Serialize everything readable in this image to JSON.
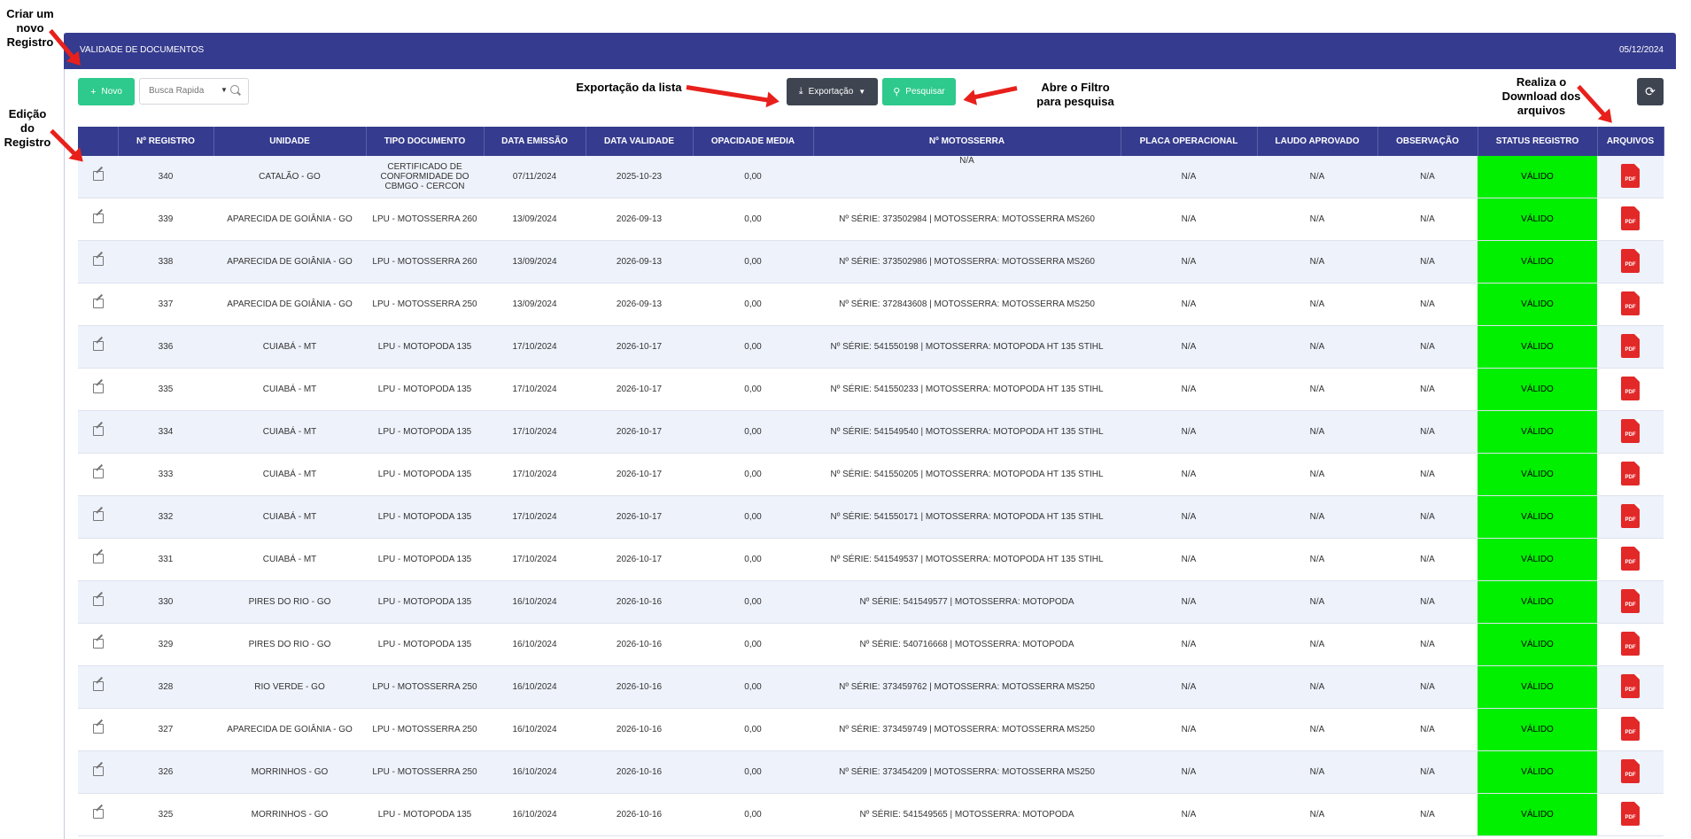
{
  "header": {
    "title": "VALIDADE DE DOCUMENTOS",
    "date": "05/12/2024"
  },
  "toolbar": {
    "novo_label": "Novo",
    "search_placeholder": "Busca Rapida",
    "export_label": "Exportação",
    "search_button_label": "Pesquisar"
  },
  "annotations": {
    "criar": "Criar um novo Registro",
    "edicao": "Edição do Registro",
    "exportacao": "Exportação da lista",
    "filtro": "Abre o Filtro para pesquisa",
    "download": "Realiza o Download dos arquivos"
  },
  "table": {
    "columns": [
      "",
      "Nº REGISTRO",
      "UNIDADE",
      "TIPO DOCUMENTO",
      "DATA EMISSÃO",
      "DATA VALIDADE",
      "OPACIDADE MEDIA",
      "Nº MOTOSSERRA",
      "PLACA OPERACIONAL",
      "LAUDO APROVADO",
      "OBSERVAÇÃO",
      "STATUS REGISTRO",
      "ARQUIVOS"
    ],
    "rows": [
      {
        "reg": "340",
        "unidade": "CATALÃO - GO",
        "tipo": "CERTIFICADO DE CONFORMIDADE DO CBMGO - CERCON",
        "emissao": "07/11/2024",
        "validade": "2025-10-23",
        "opacidade": "0,00",
        "motosserra": "N/A",
        "placa": "N/A",
        "laudo": "N/A",
        "obs": "N/A",
        "status": "VÁLIDO"
      },
      {
        "reg": "339",
        "unidade": "APARECIDA DE GOIÂNIA - GO",
        "tipo": "LPU - MOTOSSERRA 260",
        "emissao": "13/09/2024",
        "validade": "2026-09-13",
        "opacidade": "0,00",
        "motosserra": "Nº SÉRIE: 373502984 | MOTOSSERRA: MOTOSSERRA MS260",
        "placa": "N/A",
        "laudo": "N/A",
        "obs": "N/A",
        "status": "VÁLIDO"
      },
      {
        "reg": "338",
        "unidade": "APARECIDA DE GOIÂNIA - GO",
        "tipo": "LPU - MOTOSSERRA 260",
        "emissao": "13/09/2024",
        "validade": "2026-09-13",
        "opacidade": "0,00",
        "motosserra": "Nº SÉRIE: 373502986 | MOTOSSERRA: MOTOSSERRA MS260",
        "placa": "N/A",
        "laudo": "N/A",
        "obs": "N/A",
        "status": "VÁLIDO"
      },
      {
        "reg": "337",
        "unidade": "APARECIDA DE GOIÂNIA - GO",
        "tipo": "LPU - MOTOSSERRA 250",
        "emissao": "13/09/2024",
        "validade": "2026-09-13",
        "opacidade": "0,00",
        "motosserra": "Nº SÉRIE: 372843608 | MOTOSSERRA: MOTOSSERRA MS250",
        "placa": "N/A",
        "laudo": "N/A",
        "obs": "N/A",
        "status": "VÁLIDO"
      },
      {
        "reg": "336",
        "unidade": "CUIABÁ - MT",
        "tipo": "LPU - MOTOPODA 135",
        "emissao": "17/10/2024",
        "validade": "2026-10-17",
        "opacidade": "0,00",
        "motosserra": "Nº SÉRIE: 541550198 | MOTOSSERRA: MOTOPODA HT 135 STIHL",
        "placa": "N/A",
        "laudo": "N/A",
        "obs": "N/A",
        "status": "VÁLIDO"
      },
      {
        "reg": "335",
        "unidade": "CUIABÁ - MT",
        "tipo": "LPU - MOTOPODA 135",
        "emissao": "17/10/2024",
        "validade": "2026-10-17",
        "opacidade": "0,00",
        "motosserra": "Nº SÉRIE: 541550233 | MOTOSSERRA: MOTOPODA HT 135 STIHL",
        "placa": "N/A",
        "laudo": "N/A",
        "obs": "N/A",
        "status": "VÁLIDO"
      },
      {
        "reg": "334",
        "unidade": "CUIABÁ - MT",
        "tipo": "LPU - MOTOPODA 135",
        "emissao": "17/10/2024",
        "validade": "2026-10-17",
        "opacidade": "0,00",
        "motosserra": "Nº SÉRIE: 541549540 | MOTOSSERRA: MOTOPODA HT 135 STIHL",
        "placa": "N/A",
        "laudo": "N/A",
        "obs": "N/A",
        "status": "VÁLIDO"
      },
      {
        "reg": "333",
        "unidade": "CUIABÁ - MT",
        "tipo": "LPU - MOTOPODA 135",
        "emissao": "17/10/2024",
        "validade": "2026-10-17",
        "opacidade": "0,00",
        "motosserra": "Nº SÉRIE: 541550205 | MOTOSSERRA: MOTOPODA HT 135 STIHL",
        "placa": "N/A",
        "laudo": "N/A",
        "obs": "N/A",
        "status": "VÁLIDO"
      },
      {
        "reg": "332",
        "unidade": "CUIABÁ - MT",
        "tipo": "LPU - MOTOPODA 135",
        "emissao": "17/10/2024",
        "validade": "2026-10-17",
        "opacidade": "0,00",
        "motosserra": "Nº SÉRIE: 541550171 | MOTOSSERRA: MOTOPODA HT 135 STIHL",
        "placa": "N/A",
        "laudo": "N/A",
        "obs": "N/A",
        "status": "VÁLIDO"
      },
      {
        "reg": "331",
        "unidade": "CUIABÁ - MT",
        "tipo": "LPU - MOTOPODA 135",
        "emissao": "17/10/2024",
        "validade": "2026-10-17",
        "opacidade": "0,00",
        "motosserra": "Nº SÉRIE: 541549537 | MOTOSSERRA: MOTOPODA HT 135 STIHL",
        "placa": "N/A",
        "laudo": "N/A",
        "obs": "N/A",
        "status": "VÁLIDO"
      },
      {
        "reg": "330",
        "unidade": "PIRES DO RIO - GO",
        "tipo": "LPU - MOTOPODA 135",
        "emissao": "16/10/2024",
        "validade": "2026-10-16",
        "opacidade": "0,00",
        "motosserra": "Nº SÉRIE: 541549577 | MOTOSSERRA: MOTOPODA",
        "placa": "N/A",
        "laudo": "N/A",
        "obs": "N/A",
        "status": "VÁLIDO"
      },
      {
        "reg": "329",
        "unidade": "PIRES DO RIO - GO",
        "tipo": "LPU - MOTOPODA 135",
        "emissao": "16/10/2024",
        "validade": "2026-10-16",
        "opacidade": "0,00",
        "motosserra": "Nº SÉRIE: 540716668 | MOTOSSERRA: MOTOPODA",
        "placa": "N/A",
        "laudo": "N/A",
        "obs": "N/A",
        "status": "VÁLIDO"
      },
      {
        "reg": "328",
        "unidade": "RIO VERDE - GO",
        "tipo": "LPU - MOTOSSERRA 250",
        "emissao": "16/10/2024",
        "validade": "2026-10-16",
        "opacidade": "0,00",
        "motosserra": "Nº SÉRIE: 373459762 | MOTOSSERRA: MOTOSSERRA MS250",
        "placa": "N/A",
        "laudo": "N/A",
        "obs": "N/A",
        "status": "VÁLIDO"
      },
      {
        "reg": "327",
        "unidade": "APARECIDA DE GOIÂNIA - GO",
        "tipo": "LPU - MOTOSSERRA 250",
        "emissao": "16/10/2024",
        "validade": "2026-10-16",
        "opacidade": "0,00",
        "motosserra": "Nº SÉRIE: 373459749 | MOTOSSERRA: MOTOSSERRA MS250",
        "placa": "N/A",
        "laudo": "N/A",
        "obs": "N/A",
        "status": "VÁLIDO"
      },
      {
        "reg": "326",
        "unidade": "MORRINHOS - GO",
        "tipo": "LPU - MOTOSSERRA 250",
        "emissao": "16/10/2024",
        "validade": "2026-10-16",
        "opacidade": "0,00",
        "motosserra": "Nº SÉRIE: 373454209 | MOTOSSERRA: MOTOSSERRA MS250",
        "placa": "N/A",
        "laudo": "N/A",
        "obs": "N/A",
        "status": "VÁLIDO"
      },
      {
        "reg": "325",
        "unidade": "MORRINHOS - GO",
        "tipo": "LPU - MOTOPODA 135",
        "emissao": "16/10/2024",
        "validade": "2026-10-16",
        "opacidade": "0,00",
        "motosserra": "Nº SÉRIE: 541549565 | MOTOSSERRA: MOTOPODA",
        "placa": "N/A",
        "laudo": "N/A",
        "obs": "N/A",
        "status": "VÁLIDO"
      }
    ],
    "pdf_label": "PDF"
  },
  "colors": {
    "header_bg": "#353b8e",
    "status_valid": "#00f000",
    "accent_green": "#2ec98c",
    "pdf_red": "#e32828",
    "arrow_red": "#e8201c"
  }
}
